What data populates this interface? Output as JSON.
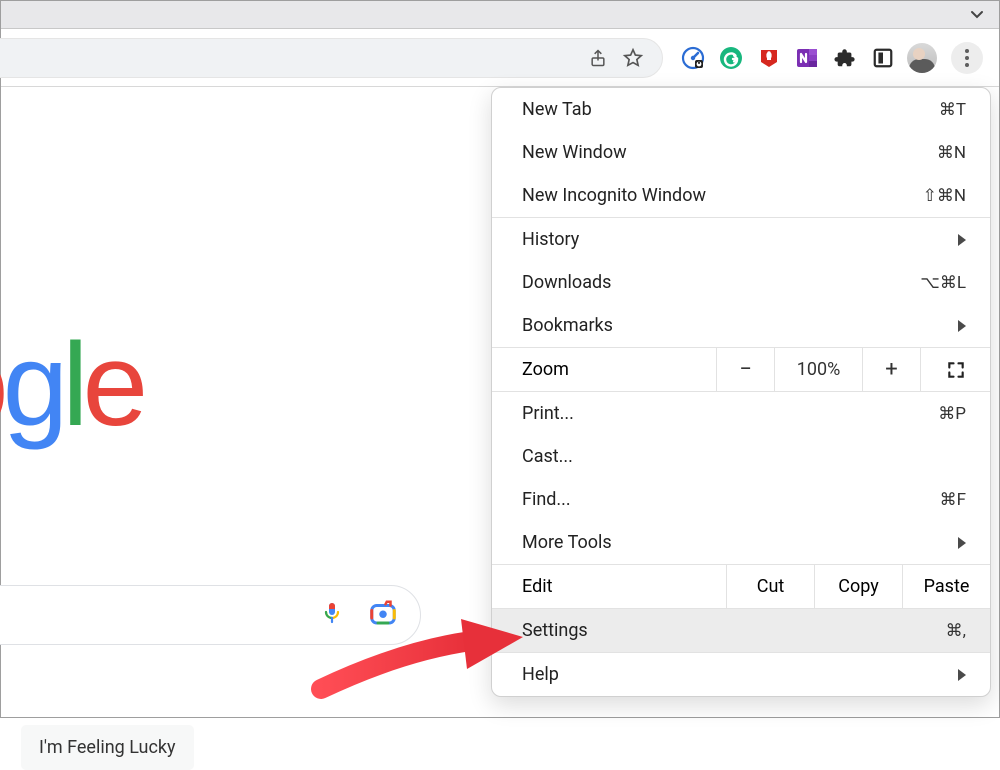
{
  "toolbar": {
    "icons": {
      "share": "share-icon",
      "star": "star-icon",
      "kebab": "kebab-menu-icon"
    },
    "extensions": [
      "onetab",
      "grammarly",
      "adblock",
      "onenote",
      "extensions",
      "reader"
    ]
  },
  "page": {
    "logo_text": "ogle",
    "lucky_button": "I'm Feeling Lucky"
  },
  "menu": {
    "new_tab": {
      "label": "New Tab",
      "shortcut": "⌘T"
    },
    "new_window": {
      "label": "New Window",
      "shortcut": "⌘N"
    },
    "new_incognito": {
      "label": "New Incognito Window",
      "shortcut": "⇧⌘N"
    },
    "history": {
      "label": "History"
    },
    "downloads": {
      "label": "Downloads",
      "shortcut": "⌥⌘L"
    },
    "bookmarks": {
      "label": "Bookmarks"
    },
    "zoom": {
      "label": "Zoom",
      "minus": "−",
      "value": "100%",
      "plus": "+"
    },
    "print": {
      "label": "Print...",
      "shortcut": "⌘P"
    },
    "cast": {
      "label": "Cast..."
    },
    "find": {
      "label": "Find...",
      "shortcut": "⌘F"
    },
    "more_tools": {
      "label": "More Tools"
    },
    "edit": {
      "label": "Edit",
      "cut": "Cut",
      "copy": "Copy",
      "paste": "Paste"
    },
    "settings": {
      "label": "Settings",
      "shortcut": "⌘,"
    },
    "help": {
      "label": "Help"
    }
  }
}
